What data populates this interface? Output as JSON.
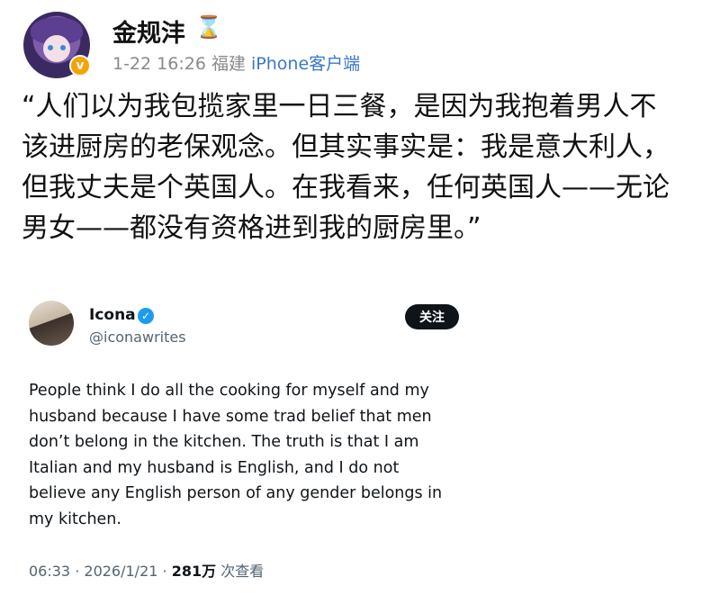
{
  "post": {
    "author": "金规沣",
    "author_badge": "hourglass-icon",
    "time": "1-22 16:26",
    "location": "福建",
    "source": "iPhone客户端",
    "text_lines": [
      "“人们以为我包揽家里一日三餐，是因为我抱着男人不",
      "该进厨房的老保观念。但其实事实是：我是意大利人，",
      "但我丈夫是个英国人。在我看来，任何英国人——无论",
      "男女——都没有资格进到我的厨房里。”"
    ]
  },
  "tweet": {
    "name": "Icona",
    "handle": "@iconawrites",
    "follow_label": "关注",
    "body_lines": [
      "People think I do all the cooking for myself and my",
      "husband because I have some trad belief that men",
      "don’t belong in the kitchen. The truth is that I am",
      "Italian and my husband is English, and I do not",
      "believe any English person of any gender belongs in",
      "my kitchen."
    ],
    "time": "06:33",
    "date": "2026/1/21",
    "views": "281万",
    "views_label": "次查看"
  },
  "colors": {
    "meta_gray": "#8a8a8a",
    "source_blue": "#3a78c8",
    "verified_orange": "#f6a300",
    "twitter_blue": "#1d9bf0"
  }
}
